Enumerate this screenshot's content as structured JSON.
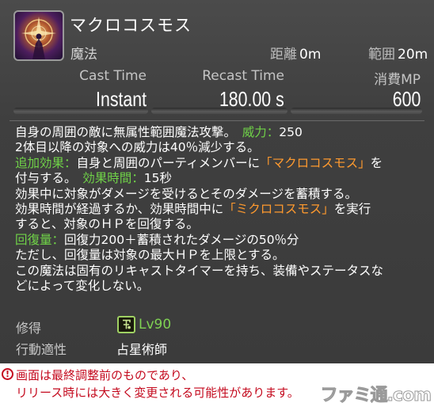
{
  "action": {
    "name": "マクロコスモス",
    "icon": "macrocosmos-icon",
    "category": "魔法",
    "range_label": "距離",
    "range_value": "0m",
    "radius_label": "範囲",
    "radius_value": "20m"
  },
  "stats": {
    "cast_label": "Cast Time",
    "cast_value": "Instant",
    "recast_label": "Recast Time",
    "recast_value": "180.00 s",
    "mp_label": "消費MP",
    "mp_value": "600"
  },
  "description": {
    "l1a": "自身の周囲の敵に無属性範囲魔法攻撃。　",
    "l1b": "威力：",
    "l1c": "250",
    "l2": "2体目以降の対象への威力は40％減少する。",
    "l3a": "追加効果：",
    "l3b": "自身と周囲のパーティメンバーに",
    "l3c": "「マクロコスモス」",
    "l3d": "を",
    "l4a": "付与する。　",
    "l4b": "効果時間：",
    "l4c": "15秒",
    "l5": "効果中に対象がダメージを受けるとそのダメージを蓄積する。",
    "l6a": "効果時間が経過するか、効果時間中に",
    "l6b": "「ミクロコスモス」",
    "l6c": "を実行",
    "l7": "すると、対象のＨＰを回復する。",
    "l8a": "回復量：",
    "l8b": "回復力200＋蓄積されたダメージの50％分",
    "l9": "ただし、回復量は対象の最大ＨＰを上限とする。",
    "l10": "この魔法は固有のリキャストタイマーを持ち、装備やステータスな",
    "l11": "どによって変化しない。"
  },
  "requirements": {
    "acquired_label": "修得",
    "level_icon": "astrologian-job-icon",
    "level": "Lv90",
    "job_label": "行動適性",
    "job": "占星術師"
  },
  "notice": {
    "icon": "warning-icon",
    "line1": "画面は最終調整前のものであり、",
    "line2": "リリース時には大きく変更される可能性があります。",
    "watermark": "ファミ通.com"
  },
  "colors": {
    "panel": "#3f3f3f",
    "highlight_green": "#70d348",
    "highlight_orange": "#ff9a2e",
    "notice_red": "#c40a1e"
  }
}
